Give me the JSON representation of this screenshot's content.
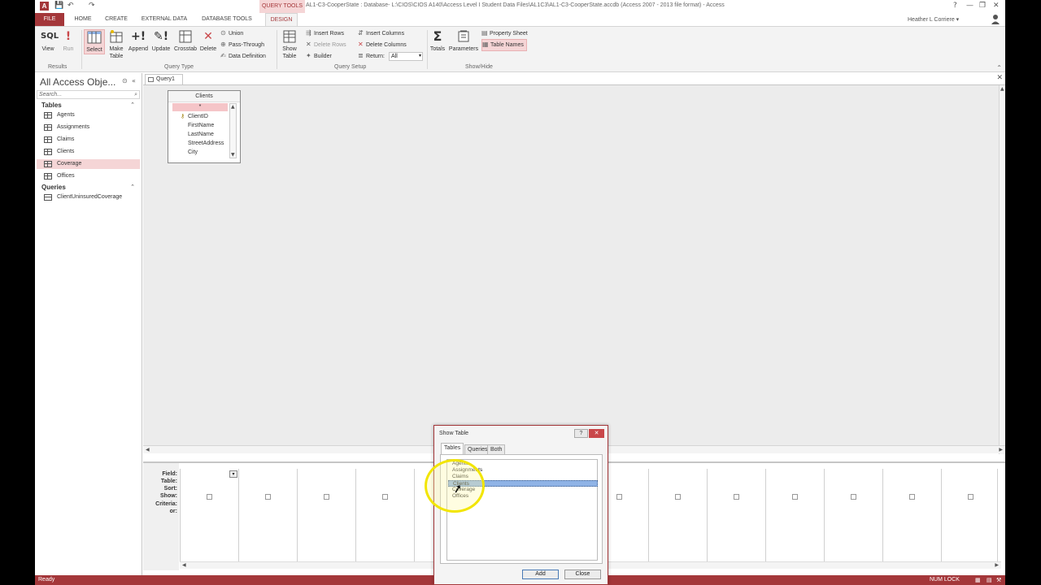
{
  "titlebar": {
    "quick_access": [
      "💾",
      "↶",
      "↷"
    ],
    "context_tab": "QUERY TOOLS",
    "title": "AL1-C3-CooperState : Database- L:\\CIOS\\CIOS A140\\Access Level I Student Data Files\\AL1C3\\AL1-C3-CooperState.accdb (Access 2007 - 2013 file format) - Access",
    "help": "?",
    "window_buttons": [
      "?",
      "—",
      "❐",
      "✕"
    ]
  },
  "tabs": {
    "file": "FILE",
    "items": [
      "HOME",
      "CREATE",
      "EXTERNAL DATA",
      "DATABASE TOOLS",
      "DESIGN"
    ]
  },
  "user": {
    "name": "Heather L Corriere ▾"
  },
  "ribbon": {
    "results": {
      "group": "Results",
      "view": "View",
      "view_icon": "SQL",
      "run": "Run",
      "run_icon": "!"
    },
    "query_type": {
      "group": "Query Type",
      "select": "Select",
      "make_table": "Make Table",
      "append": "Append",
      "update": "Update",
      "crosstab": "Crosstab",
      "delete": "Delete",
      "union": "Union",
      "pass_through": "Pass-Through",
      "data_definition": "Data Definition"
    },
    "query_setup": {
      "group": "Query Setup",
      "show_table": "Show Table",
      "insert_rows": "Insert Rows",
      "delete_rows": "Delete Rows",
      "builder": "Builder",
      "insert_columns": "Insert Columns",
      "delete_columns": "Delete Columns",
      "return_label": "Return:",
      "return_value": "All"
    },
    "show_hide": {
      "group": "Show/Hide",
      "totals": "Totals",
      "totals_icon": "Σ",
      "parameters": "Parameters",
      "property_sheet": "Property Sheet",
      "table_names": "Table Names"
    }
  },
  "nav": {
    "title": "All Access Obje...",
    "search_placeholder": "Search...",
    "tables_header": "Tables",
    "tables": [
      "Agents",
      "Assignments",
      "Claims",
      "Clients",
      "Coverage",
      "Offices"
    ],
    "selected_table": "Coverage",
    "queries_header": "Queries",
    "queries": [
      "ClientUninsuredCoverage"
    ]
  },
  "document": {
    "tab_label": "Query1",
    "table_box": {
      "title": "Clients",
      "star": "*",
      "fields": [
        "ClientID",
        "FirstName",
        "LastName",
        "StreetAddress",
        "City"
      ]
    },
    "grid_labels": [
      "Field:",
      "Table:",
      "Sort:",
      "Show:",
      "Criteria:",
      "or:"
    ]
  },
  "dialog": {
    "title": "Show Table",
    "help": "?",
    "tabs": [
      "Tables",
      "Queries",
      "Both"
    ],
    "items": [
      "Agents",
      "Assignments",
      "Claims",
      "Clients",
      "Coverage",
      "Offices"
    ],
    "selected": "Clients",
    "add_label": "Add",
    "close_label": "Close"
  },
  "status": {
    "ready": "Ready",
    "numlock": "NUM LOCK"
  },
  "colors": {
    "accent": "#a4373a",
    "selection": "#f5d5d6"
  }
}
